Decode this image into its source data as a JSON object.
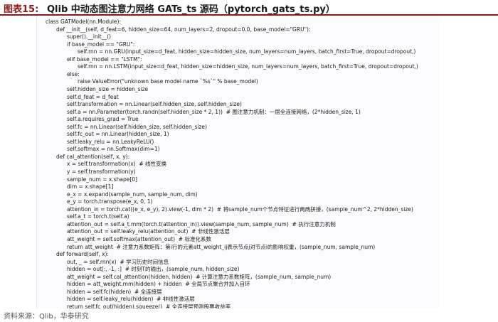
{
  "header": {
    "figure_label": "图表15:",
    "title": "Qlib 中动态图注意力网络 GATs_ts 源码（pytorch_gats_ts.py）"
  },
  "code_lines": [
    {
      "indent": 0,
      "text": "class GATModel(nn.Module):"
    },
    {
      "indent": 1,
      "text": "def __init__(self, d_feat=6, hidden_size=64, num_layers=2, dropout=0.0, base_model=\"GRU\"):"
    },
    {
      "indent": 2,
      "text": "super().__init__()"
    },
    {
      "indent": 2,
      "text": "if base_model == \"GRU\":"
    },
    {
      "indent": 3,
      "text": "self.rnn = nn.GRU(input_size=d_feat, hidden_size=hidden_size, num_layers=num_layers, batch_first=True, dropout=dropout,)"
    },
    {
      "indent": 2,
      "text": "elif base_model == \"LSTM\":"
    },
    {
      "indent": 3,
      "text": "self.rnn = nn.LSTM(input_size=d_feat, hidden_size=hidden_size, num_layers=num_layers, batch_first=True, dropout=dropout,)"
    },
    {
      "indent": 2,
      "text": "else:"
    },
    {
      "indent": 3,
      "text": "raise ValueError(\"unknown base model name `%s`\" % base_model)"
    },
    {
      "indent": 2,
      "text": "self.hidden_size = hidden_size"
    },
    {
      "indent": 2,
      "text": "self.d_feat = d_feat"
    },
    {
      "indent": 2,
      "text": "self.transformation = nn.Linear(self.hidden_size, self.hidden_size)"
    },
    {
      "indent": 2,
      "text": "self.a = nn.Parameter(torch.randn(self.hidden_size * 2, 1))  # 图注意力机制：一层全连接网络，(2*hidden_size, 1)"
    },
    {
      "indent": 2,
      "text": "self.a.requires_grad = True"
    },
    {
      "indent": 2,
      "text": "self.fc = nn.Linear(self.hidden_size, self.hidden_size)"
    },
    {
      "indent": 2,
      "text": "self.fc_out = nn.Linear(hidden_size, 1)"
    },
    {
      "indent": 2,
      "text": "self.leaky_relu = nn.LeakyReLU()"
    },
    {
      "indent": 2,
      "text": "self.softmax = nn.Softmax(dim=1)"
    },
    {
      "indent": 1,
      "text": "def cal_attention(self, x, y):"
    },
    {
      "indent": 2,
      "text": "x = self.transformation(x)  # 线性变换"
    },
    {
      "indent": 2,
      "text": "y = self.transformation(y)"
    },
    {
      "indent": 2,
      "text": "sample_num = x.shape[0]"
    },
    {
      "indent": 2,
      "text": "dim = x.shape[1]"
    },
    {
      "indent": 2,
      "text": "e_x = x.expand(sample_num, sample_num, dim)"
    },
    {
      "indent": 2,
      "text": "e_y = torch.transpose(e_x, 0, 1)"
    },
    {
      "indent": 2,
      "text": "attention_in = torch.cat((e_x, e_y), 2).view(-1, dim * 2)  # 将sample_num个节点特征进行两两拼接，(sample_num^2, 2*hidden_size)"
    },
    {
      "indent": 2,
      "text": "self.a_t = torch.t(self.a)"
    },
    {
      "indent": 2,
      "text": "attention_out = self.a_t.mm(torch.t(attention_in)).view(sample_num, sample_num)  # 执行注意力机制"
    },
    {
      "indent": 2,
      "text": "attention_out = self.leaky_relu(attention_out)  # 非线性激活层"
    },
    {
      "indent": 2,
      "text": "att_weight = self.softmax(attention_out)  # 标准化系数"
    },
    {
      "indent": 2,
      "text": "return att_weight  # 注意力系数矩阵：第i行的元素att_weight_ij表示节点j对节点i的影响权重，(sample_num, sample_num)"
    },
    {
      "indent": 1,
      "text": "def forward(self, x):"
    },
    {
      "indent": 2,
      "text": "out, _ = self.rnn(x)  # 学习历史时间信息"
    },
    {
      "indent": 2,
      "text": "hidden = out[:, -1, :]  # 时刻T的输出，(sample_num, hidden_size)"
    },
    {
      "indent": 2,
      "text": "att_weight = self.cal_attention(hidden, hidden)  # 计算注意力系数矩阵，(sample_num, sample_num)"
    },
    {
      "indent": 2,
      "text": "hidden = att_weight.mm(hidden) + hidden  # 全局节点聚合并加入自环"
    },
    {
      "indent": 2,
      "text": "hidden = self.fc(hidden)  # 全连接层"
    },
    {
      "indent": 2,
      "text": "hidden = self.leaky_relu(hidden)  # 非线性激活层"
    },
    {
      "indent": 2,
      "text": "return self.fc_out(hidden).squeeze()  # 全连接层预测股票收益率"
    }
  ],
  "footer": {
    "source": "资料来源：Qlib，华泰研究"
  },
  "colors": {
    "header_rule": "#8b1a1a",
    "keyword": "#1f1fb4",
    "string": "#b42020"
  }
}
